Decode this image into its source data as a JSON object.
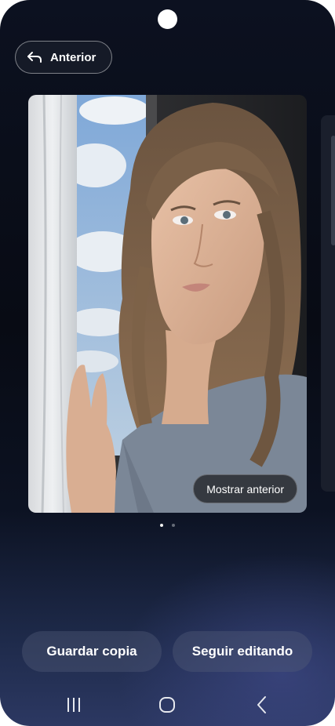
{
  "header": {
    "back_label": "Anterior"
  },
  "photo": {
    "show_previous_label": "Mostrar anterior"
  },
  "pagination": {
    "total": 2,
    "current": 1
  },
  "actions": {
    "save_copy_label": "Guardar copia",
    "continue_editing_label": "Seguir editando"
  },
  "icons": {
    "back": "back-arrow-icon",
    "recents": "recents-icon",
    "home": "home-icon",
    "nav_back": "nav-back-icon"
  },
  "colors": {
    "background_top": "#0c1120",
    "background_bottom": "#2c3862",
    "button_fill": "#151a27"
  }
}
